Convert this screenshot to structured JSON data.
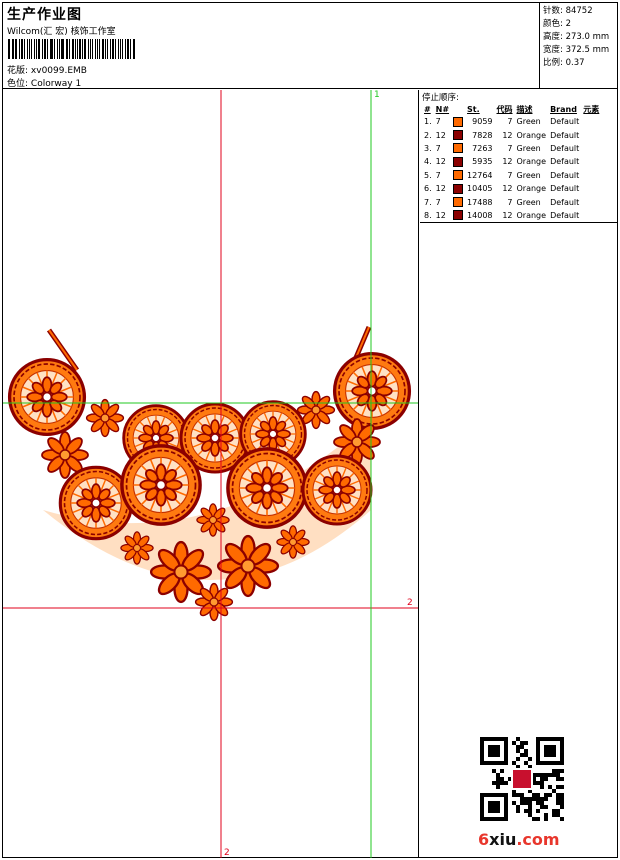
{
  "header": {
    "title": "生产作业图",
    "company": "Wilcom(汇 宏) 核饰工作室",
    "design_label": "花版:",
    "design_name": "xv0099.EMB",
    "colorway_label": "色位:",
    "colorway_name": "Colorway 1"
  },
  "info": {
    "stitches_label": "针数:",
    "stitches": "84752",
    "colors_label": "颜色:",
    "colors": "2",
    "height_label": "高度:",
    "height": "273.0 mm",
    "width_label": "宽度:",
    "width": "372.5 mm",
    "ratio_label": "比例:",
    "ratio": "0.37"
  },
  "canvas": {
    "marker_top": "1",
    "marker_right": "2",
    "marker_bottom": "2"
  },
  "stops": {
    "title": "停止顺序:",
    "headers": [
      "#",
      "N#",
      "St.",
      "代码",
      "描述",
      "Brand",
      "元素"
    ],
    "rows": [
      {
        "idx": "1.",
        "needle": "7",
        "color": "#ff6a00",
        "stitches": "9059",
        "code": "7",
        "desc": "Green",
        "brand": "Default"
      },
      {
        "idx": "2.",
        "needle": "12",
        "color": "#8b0000",
        "stitches": "7828",
        "code": "12",
        "desc": "Orange",
        "brand": "Default"
      },
      {
        "idx": "3.",
        "needle": "7",
        "color": "#ff6a00",
        "stitches": "7263",
        "code": "7",
        "desc": "Green",
        "brand": "Default"
      },
      {
        "idx": "4.",
        "needle": "12",
        "color": "#8b0000",
        "stitches": "5935",
        "code": "12",
        "desc": "Orange",
        "brand": "Default"
      },
      {
        "idx": "5.",
        "needle": "7",
        "color": "#ff6a00",
        "stitches": "12764",
        "code": "7",
        "desc": "Green",
        "brand": "Default"
      },
      {
        "idx": "6.",
        "needle": "12",
        "color": "#8b0000",
        "stitches": "10405",
        "code": "12",
        "desc": "Orange",
        "brand": "Default"
      },
      {
        "idx": "7.",
        "needle": "7",
        "color": "#ff6a00",
        "stitches": "17488",
        "code": "7",
        "desc": "Green",
        "brand": "Default"
      },
      {
        "idx": "8.",
        "needle": "12",
        "color": "#8b0000",
        "stitches": "14008",
        "code": "12",
        "desc": "Orange",
        "brand": "Default"
      }
    ]
  },
  "logo": {
    "part1": "6",
    "part2": "xiu",
    "part3": ".com"
  },
  "colors": {
    "thread_orange": "#ff6a00",
    "thread_dark_red": "#8b0000",
    "guide_red": "#e0001b",
    "guide_green": "#21c821"
  }
}
